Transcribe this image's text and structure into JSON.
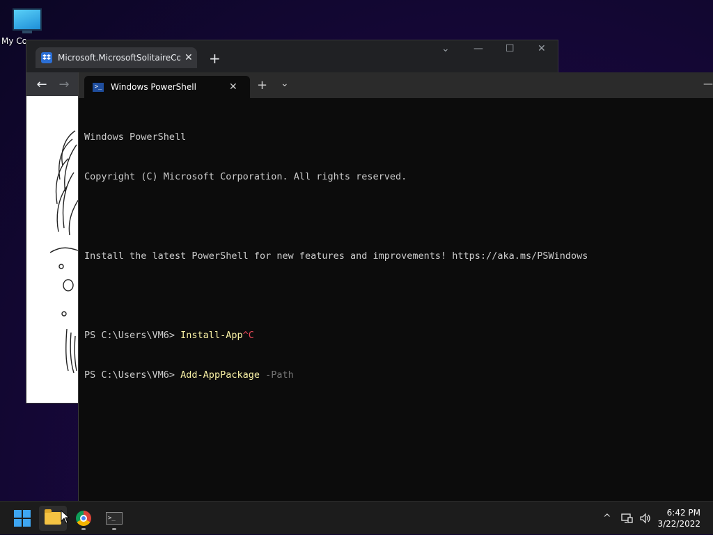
{
  "desktop": {
    "icon_label": "My Computer"
  },
  "browser": {
    "tab_title": "Microsoft.MicrosoftSolitaireCollection",
    "tab_close": "✕",
    "new_tab": "+",
    "win_dropdown": "⌄",
    "win_minimize": "—",
    "win_maximize": "☐",
    "win_close": "✕",
    "nav_back": "←",
    "nav_forward": "→"
  },
  "terminal": {
    "tab_title": "Windows PowerShell",
    "tab_close": "✕",
    "new_tab": "+",
    "dropdown": "⌄",
    "minimize": "—",
    "lines": {
      "l1": "Windows PowerShell",
      "l2": "Copyright (C) Microsoft Corporation. All rights reserved.",
      "l4": "Install the latest PowerShell for new features and improvements! https://aka.ms/PSWindows",
      "l6_prompt": "PS C:\\Users\\VM6> ",
      "l6_cmd": "Install-App",
      "l6_ctrl": "^C",
      "l7_prompt": "PS C:\\Users\\VM6> ",
      "l7_cmd": "Add-AppPackage",
      "l7_param": " -Path"
    }
  },
  "taskbar": {
    "time": "6:42 PM",
    "date": "3/22/2022",
    "tray_chevron": "^",
    "colors": {
      "accent": "#3ea6f2",
      "background": "#1c1c1c"
    }
  }
}
